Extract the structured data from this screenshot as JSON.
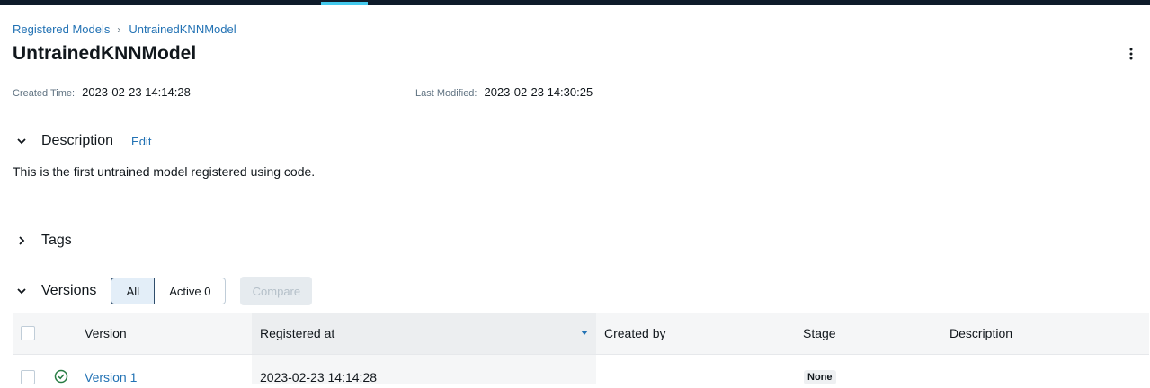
{
  "breadcrumb": {
    "root": "Registered Models",
    "current": "UntrainedKNNModel"
  },
  "model": {
    "name": "UntrainedKNNModel"
  },
  "meta": {
    "created_label": "Created Time:",
    "created_value": "2023-02-23 14:14:28",
    "modified_label": "Last Modified:",
    "modified_value": "2023-02-23 14:30:25"
  },
  "description": {
    "title": "Description",
    "edit_label": "Edit",
    "text": "This is the first untrained model registered using code."
  },
  "tags": {
    "title": "Tags"
  },
  "versions": {
    "title": "Versions",
    "filter_all": "All",
    "filter_active": "Active 0",
    "compare_label": "Compare",
    "columns": [
      "Version",
      "Registered at",
      "Created by",
      "Stage",
      "Description"
    ],
    "rows": [
      {
        "version": "Version 1",
        "registered_at": "2023-02-23 14:14:28",
        "created_by": "",
        "stage": "None",
        "description": ""
      }
    ]
  },
  "colors": {
    "accent": "#2272b4",
    "topbar": "#0e1b2a",
    "tab_indicator": "#43c9ed",
    "success": "#277c43"
  },
  "icons": {
    "breadcrumb_separator": "chevron-right-icon",
    "menu": "kebab-menu-icon",
    "expanded": "chevron-down-icon",
    "collapsed": "chevron-right-icon",
    "status": "check-circle-icon",
    "sort": "sort-descending-icon"
  }
}
